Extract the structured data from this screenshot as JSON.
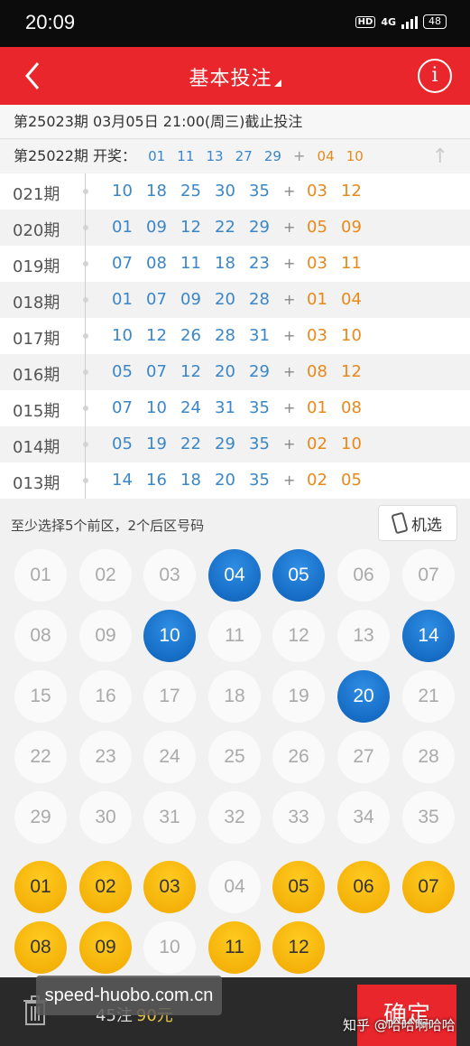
{
  "status": {
    "time": "20:09",
    "hd": "HD",
    "network": "4G",
    "battery": "48"
  },
  "header": {
    "title": "基本投注"
  },
  "deadline": "第25023期  03月05日 21:00(周三)截止投注",
  "last_draw": {
    "label": "第25022期 开奖：",
    "front": [
      "01",
      "11",
      "13",
      "27",
      "29"
    ],
    "plus": "+",
    "back": [
      "04",
      "10"
    ]
  },
  "history": [
    {
      "issue": "021期",
      "front": [
        "10",
        "18",
        "25",
        "30",
        "35"
      ],
      "back": [
        "03",
        "12"
      ]
    },
    {
      "issue": "020期",
      "front": [
        "01",
        "09",
        "12",
        "22",
        "29"
      ],
      "back": [
        "05",
        "09"
      ]
    },
    {
      "issue": "019期",
      "front": [
        "07",
        "08",
        "11",
        "18",
        "23"
      ],
      "back": [
        "03",
        "11"
      ]
    },
    {
      "issue": "018期",
      "front": [
        "01",
        "07",
        "09",
        "20",
        "28"
      ],
      "back": [
        "01",
        "04"
      ]
    },
    {
      "issue": "017期",
      "front": [
        "10",
        "12",
        "26",
        "28",
        "31"
      ],
      "back": [
        "03",
        "10"
      ]
    },
    {
      "issue": "016期",
      "front": [
        "05",
        "07",
        "12",
        "20",
        "29"
      ],
      "back": [
        "08",
        "12"
      ]
    },
    {
      "issue": "015期",
      "front": [
        "07",
        "10",
        "24",
        "31",
        "35"
      ],
      "back": [
        "01",
        "08"
      ]
    },
    {
      "issue": "014期",
      "front": [
        "05",
        "19",
        "22",
        "29",
        "35"
      ],
      "back": [
        "02",
        "10"
      ]
    },
    {
      "issue": "013期",
      "front": [
        "14",
        "16",
        "18",
        "20",
        "35"
      ],
      "back": [
        "02",
        "05"
      ]
    }
  ],
  "hint": "至少选择5个前区，2个后区号码",
  "random_button": "机选",
  "front_numbers": [
    "01",
    "02",
    "03",
    "04",
    "05",
    "06",
    "07",
    "08",
    "09",
    "10",
    "11",
    "12",
    "13",
    "14",
    "15",
    "16",
    "17",
    "18",
    "19",
    "20",
    "21",
    "22",
    "23",
    "24",
    "25",
    "26",
    "27",
    "28",
    "29",
    "30",
    "31",
    "32",
    "33",
    "34",
    "35"
  ],
  "front_selected": [
    "04",
    "05",
    "10",
    "14",
    "20"
  ],
  "back_numbers": [
    "01",
    "02",
    "03",
    "04",
    "05",
    "06",
    "07",
    "08",
    "09",
    "10",
    "11",
    "12"
  ],
  "back_selected": [
    "01",
    "02",
    "03",
    "05",
    "06",
    "07",
    "08",
    "09",
    "11",
    "12"
  ],
  "bottom": {
    "count": "45注",
    "price": "90元",
    "confirm": "确定"
  },
  "watermarks": {
    "site": "speed-huobo.com.cn",
    "zhihu": "知乎 @哈哈啊哈哈"
  },
  "colors": {
    "red": "#e8262b",
    "blue": "#3a86c8",
    "orange": "#e7891b",
    "ball_blue": "#0c5fb7",
    "ball_yellow": "#f0a800"
  }
}
